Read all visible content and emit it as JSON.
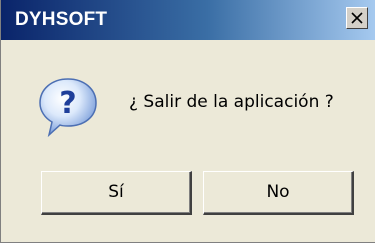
{
  "window": {
    "title": "DYHSOFT",
    "close_icon": "close-icon",
    "colors": {
      "title_gradient_start": "#0a246a",
      "title_gradient_end": "#a6caf0",
      "body_background": "#ece9d8"
    }
  },
  "dialog": {
    "icon": "question-icon",
    "message": "¿ Salir de la aplicación ?",
    "buttons": {
      "yes_label": "Sí",
      "no_label": "No"
    }
  }
}
